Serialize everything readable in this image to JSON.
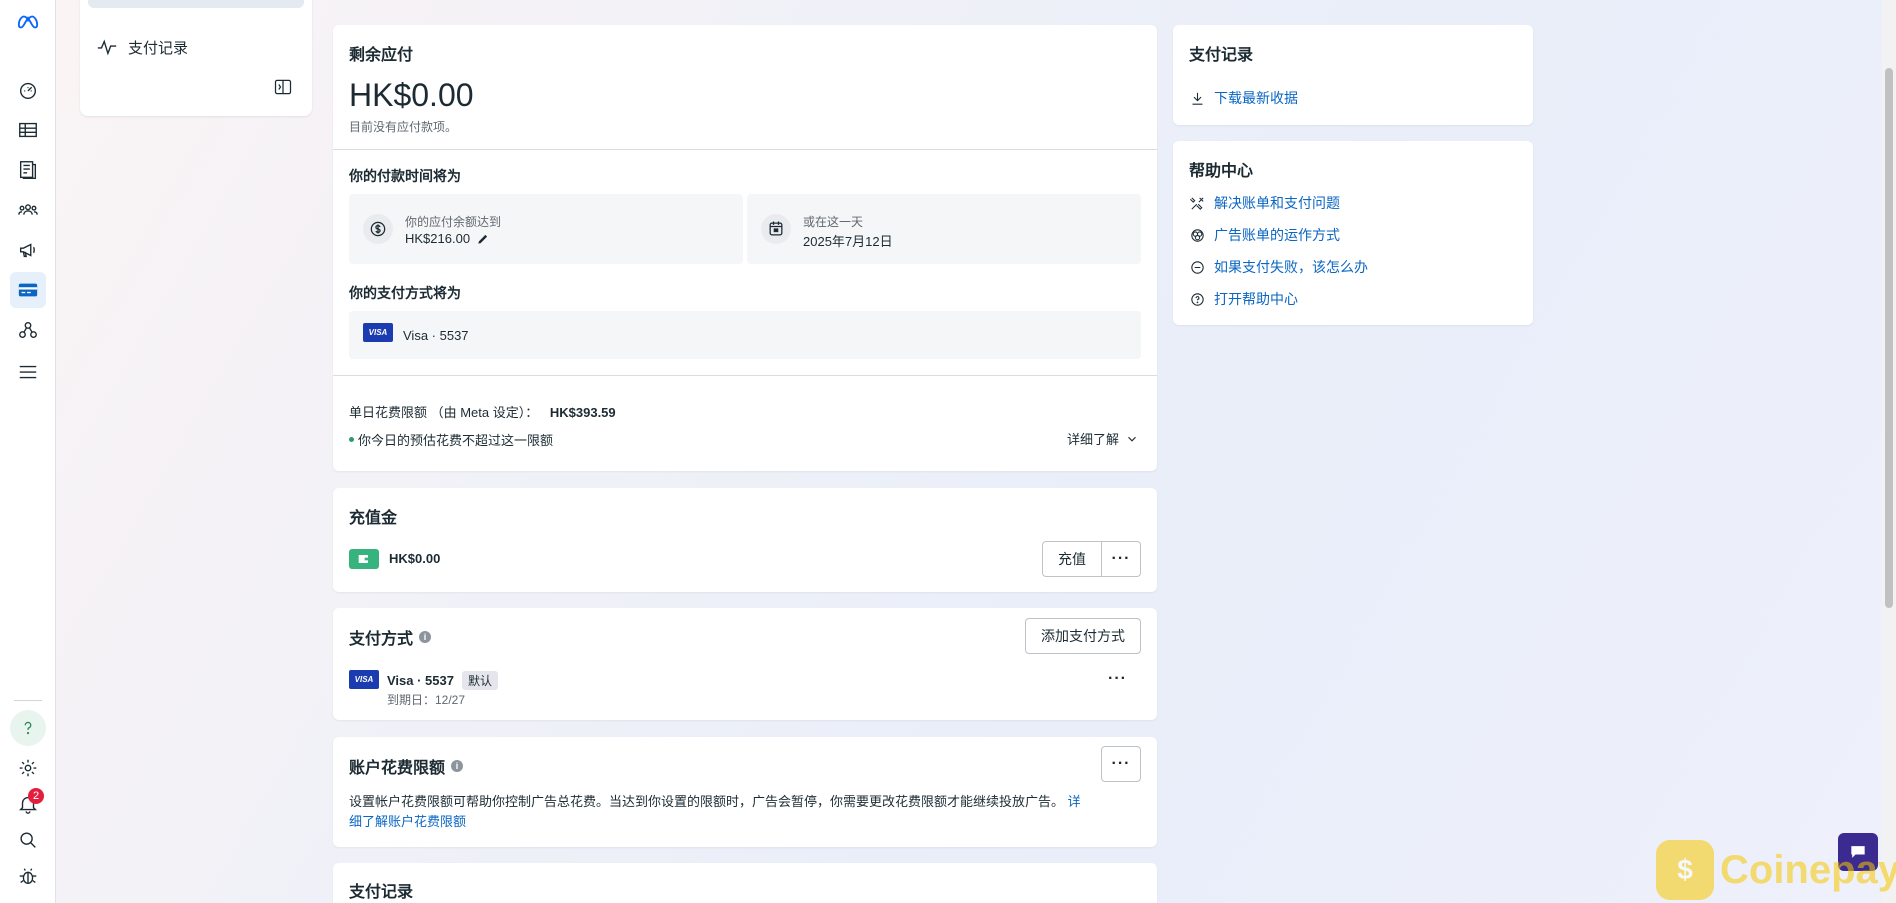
{
  "menu": {
    "items": [
      {
        "label": "支付记录",
        "icon": "activity-icon"
      }
    ]
  },
  "rail": {
    "notification_count": "2"
  },
  "remaining": {
    "title": "剩余应付",
    "amount": "HK$0.00",
    "note": "目前没有应付款项。",
    "pay_time_title": "你的付款时间将为",
    "threshold_label": "你的应付余额达到",
    "threshold_value": "HK$216.00",
    "date_label": "或在这一天",
    "date_value": "2025年7月12日",
    "method_title": "你的支付方式将为",
    "method_value": "Visa · 5537",
    "daily_limit_label": "单日花费限额 （由 Meta 设定）：",
    "daily_limit_value": "HK$393.59",
    "daily_status": "你今日的预估花费不超过这一限额",
    "learn_more": "详细了解"
  },
  "prepaid": {
    "title": "充值金",
    "amount": "HK$0.00",
    "topup_button": "充值"
  },
  "payment_methods": {
    "title": "支付方式",
    "add_button": "添加支付方式",
    "card_name": "Visa · 5537",
    "default_badge": "默认",
    "expiry": "到期日：12/27"
  },
  "spend_limit": {
    "title": "账户花费限额",
    "description": "设置帐户花费限额可帮助你控制广告总花费。当达到你设置的限额时，广告会暂停，你需要更改花费限额才能继续投放广告。",
    "link": "详细了解账户花费限额",
    "link_part1": "详",
    "link_part2": "细了解账户花费限额"
  },
  "history_bottom": {
    "title": "支付记录"
  },
  "right_history": {
    "title": "支付记录",
    "download_link": "下载最新收据"
  },
  "help_center": {
    "title": "帮助中心",
    "links": [
      "解决账单和支付问题",
      "广告账单的运作方式",
      "如果支付失败，该怎么办",
      "打开帮助中心"
    ]
  },
  "watermark": {
    "brand": "Coinepay"
  },
  "colors": {
    "accent": "#0a66c2",
    "visa": "#1a3cb0",
    "wallet": "#36b37e",
    "badge": "#e41e3f"
  }
}
